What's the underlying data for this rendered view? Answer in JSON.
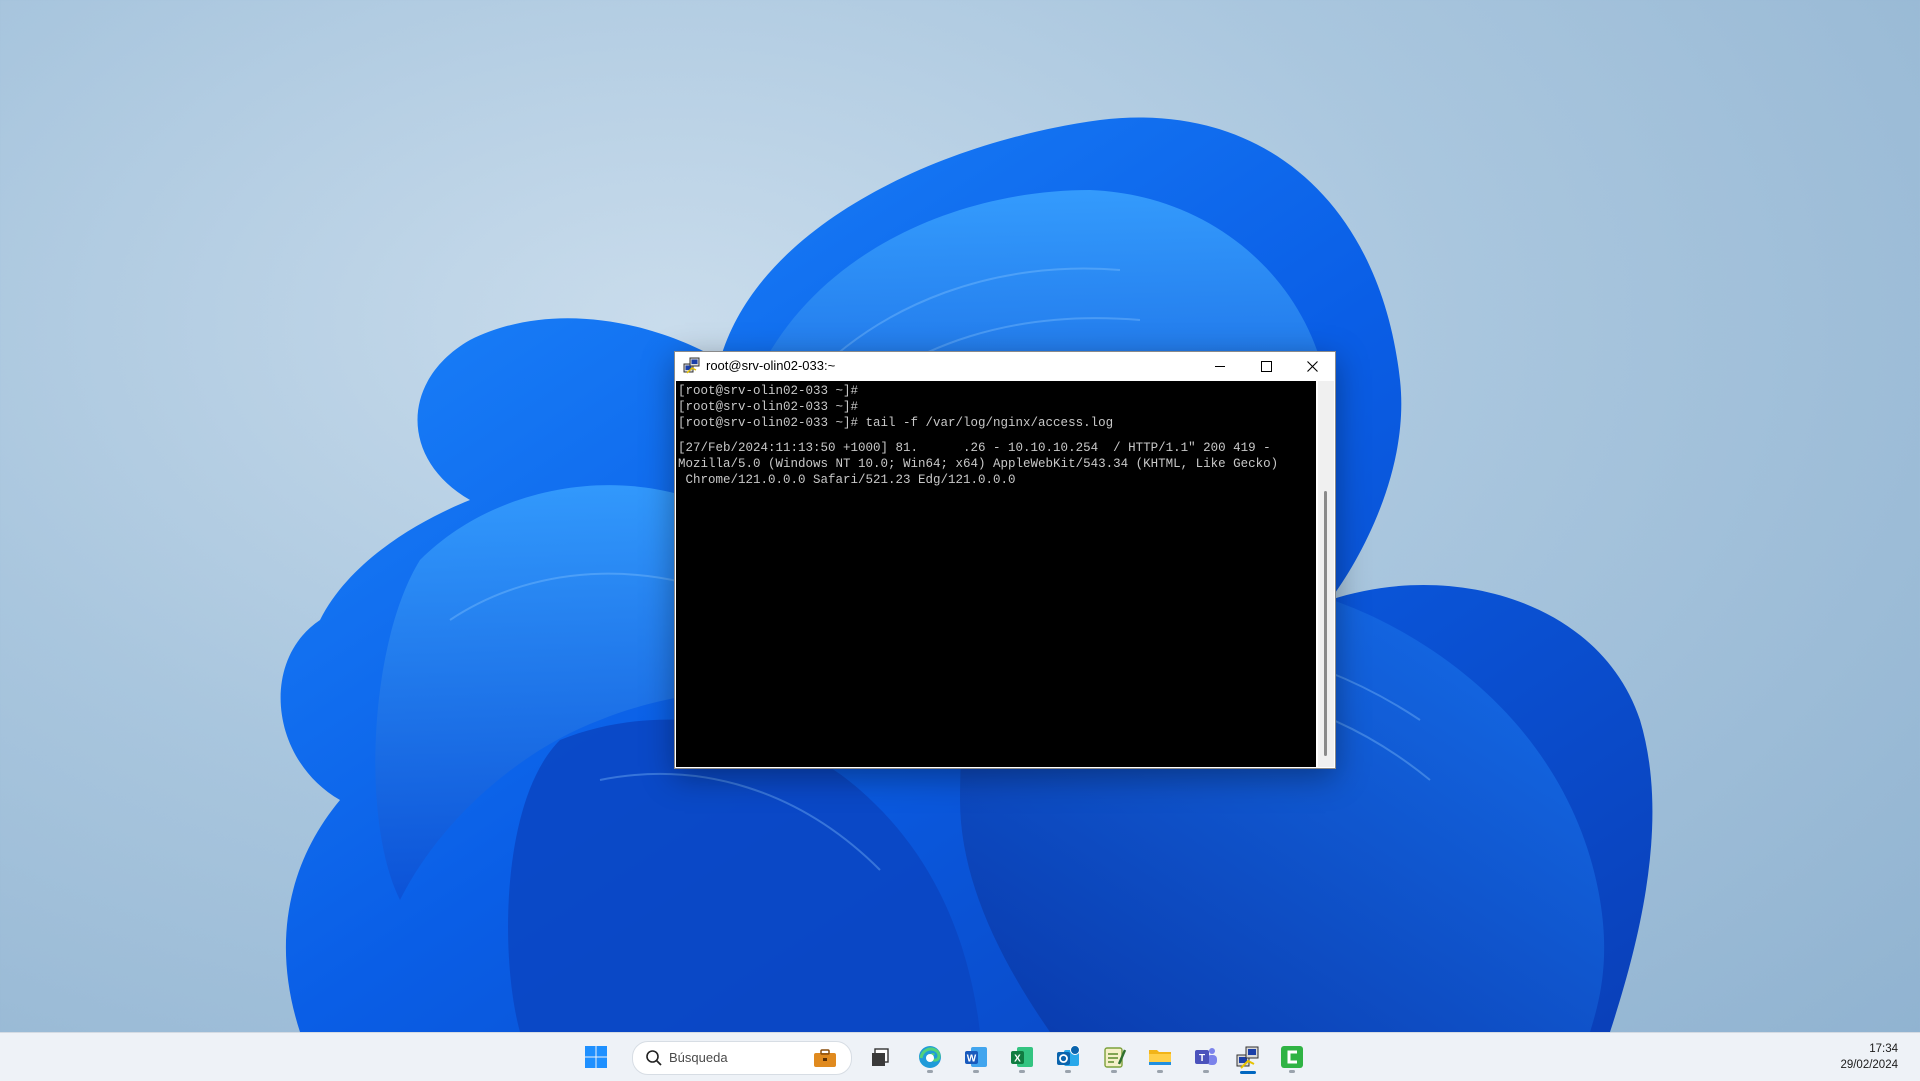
{
  "window": {
    "title": "root@srv-olin02-033:~",
    "terminal_lines": [
      "[root@srv-olin02-033 ~]#",
      "[root@srv-olin02-033 ~]#",
      "[root@srv-olin02-033 ~]# tail -f /var/log/nginx/access.log",
      "[27/Feb/2024:11:13:50 +1000] 81.      .26 - 10.10.10.254  / HTTP/1.1\" 200 419 -",
      "Mozilla/5.0 (Windows NT 10.0; Win64; x64) AppleWebKit/543.34 (KHTML, Like Gecko)",
      " Chrome/121.0.0.0 Safari/521.23 Edg/121.0.0.0"
    ],
    "icon": "putty-icon",
    "buttons": [
      "minimize-icon",
      "maximize-icon",
      "close-icon"
    ]
  },
  "taskbar": {
    "search_placeholder": "Búsqueda",
    "apps": [
      "windows-start-icon",
      "search-icon",
      "task-view-icon",
      "edge-icon",
      "word-icon",
      "excel-icon",
      "outlook-icon",
      "notepad-icon",
      "file-explorer-icon",
      "teams-icon",
      "putty-icon",
      "camtasia-icon"
    ],
    "time": "17:34",
    "date": "29/02/2024"
  },
  "colors": {
    "terminal_bg": "#000000",
    "terminal_fg": "#c8c8c8",
    "accent": "#0067c0"
  }
}
